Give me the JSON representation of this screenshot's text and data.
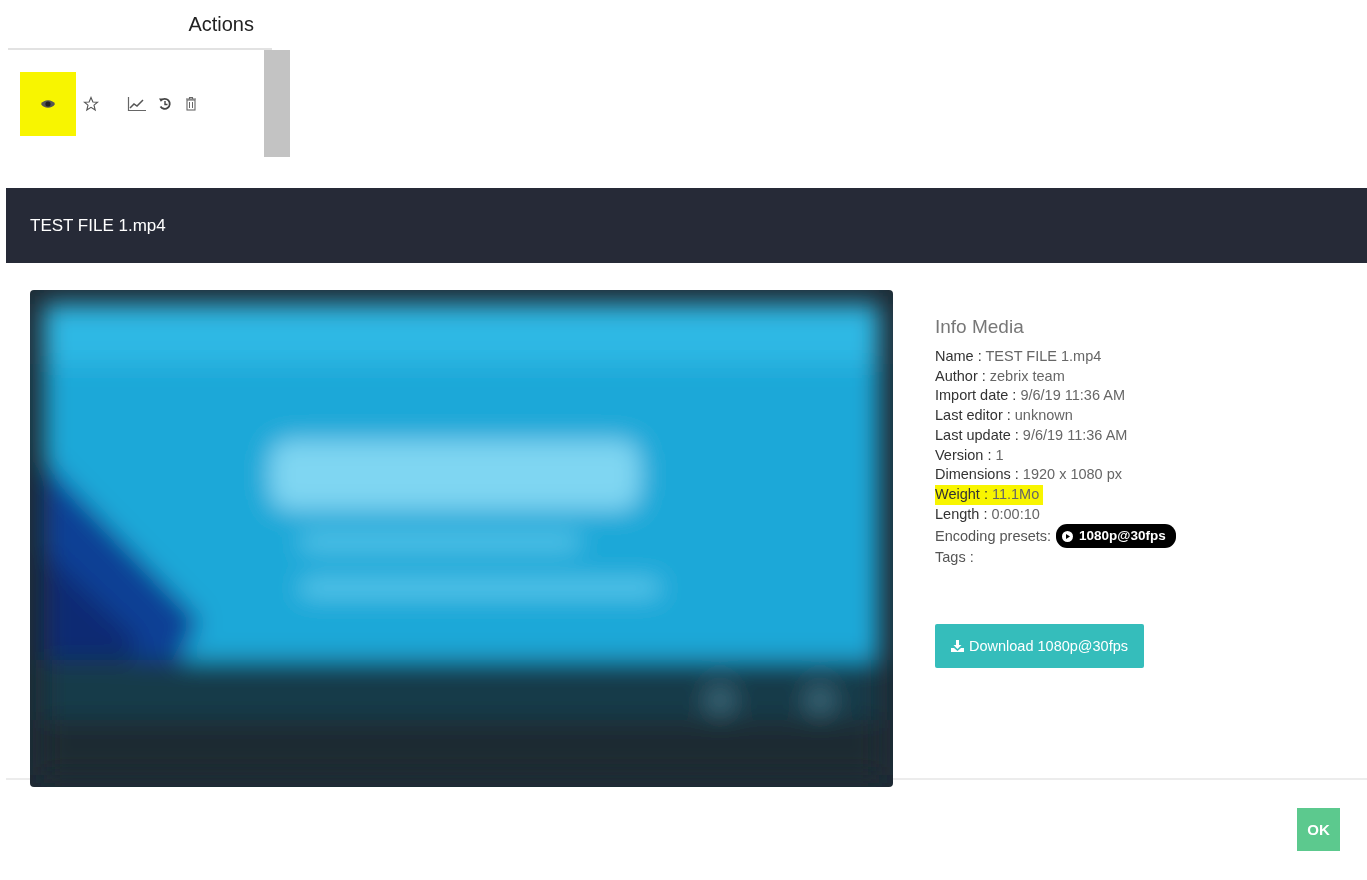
{
  "actions_panel": {
    "heading": "Actions",
    "icons": [
      {
        "kind": "view",
        "highlighted": true
      },
      {
        "kind": "favorite",
        "highlighted": false
      },
      {
        "kind": "stats",
        "highlighted": false
      },
      {
        "kind": "history",
        "highlighted": false
      },
      {
        "kind": "delete",
        "highlighted": false
      }
    ]
  },
  "dialog": {
    "title": "TEST FILE 1.mp4",
    "info": {
      "heading": "Info Media",
      "rows": [
        {
          "label": "Name :",
          "value": "TEST FILE 1.mp4",
          "highlighted": false
        },
        {
          "label": "Author :",
          "value": "zebrix team",
          "highlighted": false
        },
        {
          "label": "Import date :",
          "value": "9/6/19 11:36 AM",
          "highlighted": false
        },
        {
          "label": "Last editor :",
          "value": "unknown",
          "highlighted": false
        },
        {
          "label": "Last update :",
          "value": "9/6/19 11:36 AM",
          "highlighted": false
        },
        {
          "label": "Version :",
          "value": "1",
          "highlighted": false
        },
        {
          "label": "Dimensions :",
          "value": "1920 x 1080 px",
          "highlighted": false
        },
        {
          "label": "Weight :",
          "value": "11.1Mo",
          "highlighted": true
        },
        {
          "label": "Length :",
          "value": "0:00:10",
          "highlighted": false
        }
      ],
      "presets_label": "Encoding presets:",
      "presets": [
        "1080p@30fps"
      ],
      "tags_label": "Tags :"
    },
    "download_button": "Download 1080p@30fps",
    "ok_button": "OK"
  }
}
